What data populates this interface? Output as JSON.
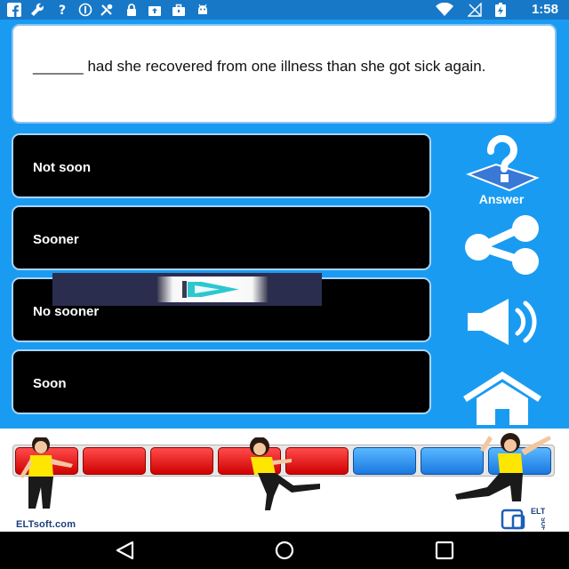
{
  "status_bar": {
    "time": "1:58",
    "icons": [
      "facebook-icon",
      "wrench-icon",
      "help-icon",
      "blocked-icon",
      "tools-icon",
      "lock-icon",
      "cloud-upload-icon",
      "briefcase-icon",
      "android-icon",
      "wifi-icon",
      "signal-icon",
      "battery-charging-icon"
    ]
  },
  "question": {
    "text": "______ had she recovered from one illness than she got sick again."
  },
  "options": [
    {
      "label": "Not soon"
    },
    {
      "label": "Sooner"
    },
    {
      "label": "No sooner"
    },
    {
      "label": "Soon"
    }
  ],
  "sidebar": {
    "answer_label": "Answer",
    "icons": [
      "answer-question-icon",
      "share-icon",
      "sound-icon",
      "home-icon"
    ]
  },
  "progress": {
    "segments": [
      "red",
      "red",
      "red",
      "red",
      "red",
      "blue",
      "blue",
      "blue"
    ],
    "colors": {
      "red": "#e50000",
      "blue": "#2d8ef0"
    }
  },
  "footer": {
    "brand": "ELTsoft.com",
    "logo_text": "ELT SOFT"
  },
  "nav_bar": {
    "icons": [
      "back-icon",
      "home-circle-icon",
      "recents-icon"
    ]
  },
  "colors": {
    "background": "#1a9bf2",
    "status_bar": "#1778c8",
    "option_bg": "#000000"
  }
}
